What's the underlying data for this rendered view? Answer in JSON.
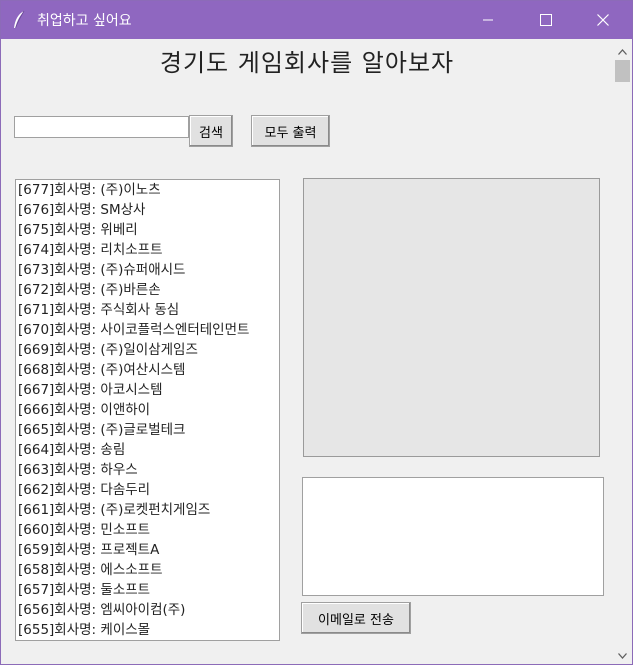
{
  "window": {
    "title": "취업하고 싶어요"
  },
  "heading": "경기도 게임회사를 알아보자",
  "search": {
    "value": "",
    "button_label": "검색"
  },
  "all_button_label": "모두 출력",
  "company_list": [
    "[677]회사명: (주)이노츠",
    "[676]회사명: SM상사",
    "[675]회사명: 위베리",
    "[674]회사명: 리치소프트",
    "[673]회사명: (주)슈퍼애시드",
    "[672]회사명: (주)바른손",
    "[671]회사명: 주식회사 동심",
    "[670]회사명: 사이코플럭스엔터테인먼트",
    "[669]회사명: (주)일이삼게임즈",
    "[668]회사명: (주)여산시스템",
    "[667]회사명: 아코시스템",
    "[666]회사명: 이앤하이",
    "[665]회사명: (주)글로벌테크",
    "[664]회사명: 송림",
    "[663]회사명: 하우스",
    "[662]회사명: 다솜두리",
    "[661]회사명: (주)로켓펀치게임즈",
    "[660]회사명: 민소프트",
    "[659]회사명: 프로젝트A",
    "[658]회사명: 에스소프트",
    "[657]회사명: 둘소프트",
    "[656]회사명: 엠씨아이컴(주)",
    "[655]회사명: 케이스몰"
  ],
  "email_button_label": "이메일로 전송",
  "colors": {
    "titlebar": "#8f67c0",
    "background": "#f0f0f0"
  }
}
